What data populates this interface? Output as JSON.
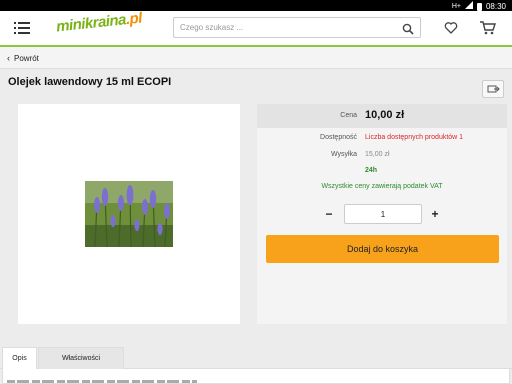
{
  "status_bar": {
    "network": "H+",
    "time": "08:30"
  },
  "header": {
    "logo_main": "minikraina",
    "logo_suffix": ".pl",
    "logo_tagline": "",
    "search_placeholder": "Czego szukasz ...",
    "search_value": ""
  },
  "nav": {
    "back_label": "Powrót"
  },
  "product": {
    "title": "Olejek lawendowy 15 ml ECOPI",
    "image_alt": "lavender",
    "price_label": "Cena",
    "price": "10,00 zł",
    "availability_label": "Dostępność",
    "availability_value": "Liczba dostępnych produktów 1",
    "shipping_label": "Wysyłka",
    "shipping_value": "15,00 zł",
    "shipping_time": "24h",
    "vat_note": "Wszystkie ceny zawierają podatek VAT",
    "quantity_minus": "−",
    "quantity": "1",
    "quantity_plus": "+",
    "add_to_cart": "Dodaj do koszyka"
  },
  "tabs": [
    {
      "label": "Opis",
      "active": true
    },
    {
      "label": "Właściwości",
      "active": false
    }
  ],
  "colors": {
    "accent_green": "#8dc63f",
    "cart_button": "#f7a21a",
    "availability_red": "#d9262c",
    "vat_green": "#2e8b2e"
  },
  "icons": [
    "menu-icon",
    "search-icon",
    "heart-icon",
    "cart-icon",
    "share-icon",
    "chevron-left-icon",
    "signal-icon",
    "battery-icon"
  ]
}
